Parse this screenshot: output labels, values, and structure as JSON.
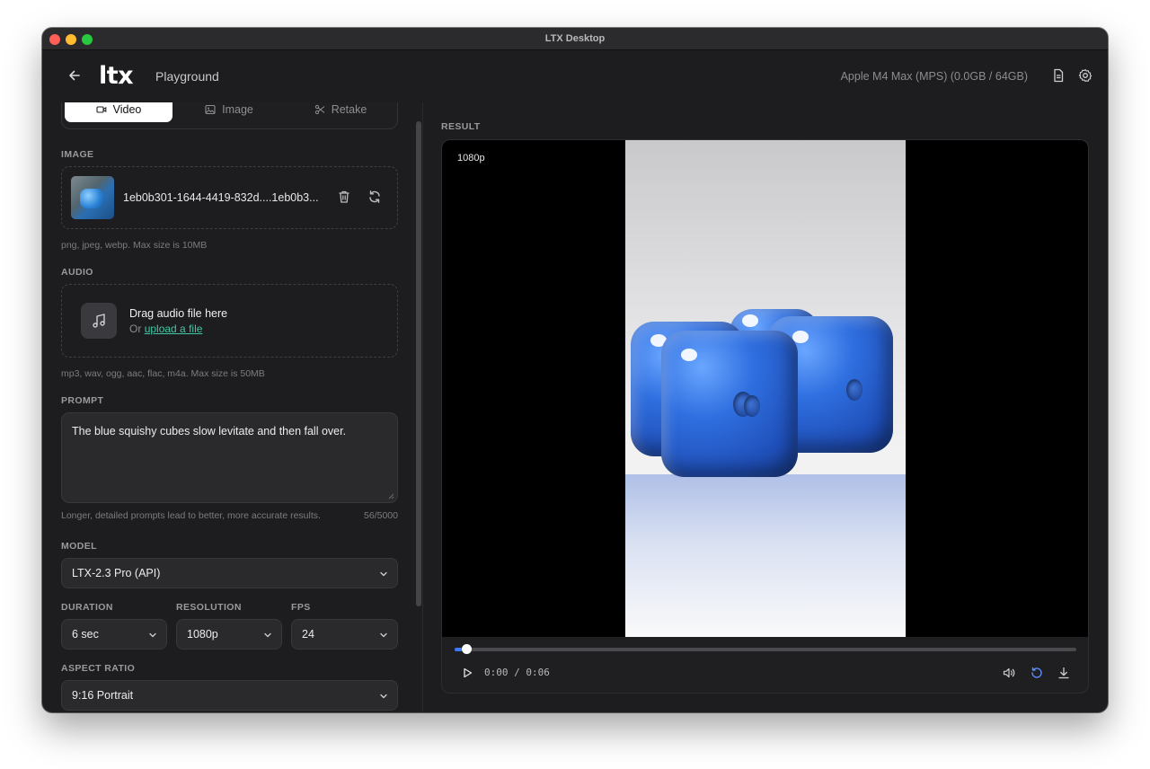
{
  "window": {
    "title": "LTX Desktop"
  },
  "header": {
    "logo": "ltx",
    "subtitle": "Playground",
    "gpu_info": "Apple M4 Max (MPS) (0.0GB / 64GB)"
  },
  "tabs": [
    {
      "label": "Video",
      "active": true
    },
    {
      "label": "Image",
      "active": false
    },
    {
      "label": "Retake",
      "active": false
    }
  ],
  "image_section": {
    "label": "IMAGE",
    "file_name": "1eb0b301-1644-4419-832d....1eb0b3...",
    "help": "png, jpeg, webp. Max size is 10MB"
  },
  "audio_section": {
    "label": "AUDIO",
    "drag_text": "Drag audio file here",
    "or_text": "Or",
    "upload_link": "upload a file",
    "help": "mp3, wav, ogg, aac, flac, m4a. Max size is 50MB"
  },
  "prompt_section": {
    "label": "PROMPT",
    "value": "The blue squishy cubes slow levitate and then fall over.",
    "help": "Longer, detailed prompts lead to better, more accurate results.",
    "count": "56/5000"
  },
  "model": {
    "label": "MODEL",
    "value": "LTX-2.3 Pro (API)"
  },
  "duration": {
    "label": "DURATION",
    "value": "6 sec"
  },
  "resolution": {
    "label": "RESOLUTION",
    "value": "1080p"
  },
  "fps": {
    "label": "FPS",
    "value": "24"
  },
  "aspect_ratio": {
    "label": "ASPECT RATIO",
    "value": "9:16 Portrait"
  },
  "result": {
    "label": "RESULT",
    "resolution_badge": "1080p",
    "time": "0:00 / 0:06",
    "progress": 0.012,
    "accent_color": "#3b7bf5",
    "loop_color": "#5b8cff"
  },
  "colors": {
    "background": "#1d1d1f",
    "panel_input": "#2a2a2d",
    "link": "#3ec8a8"
  }
}
